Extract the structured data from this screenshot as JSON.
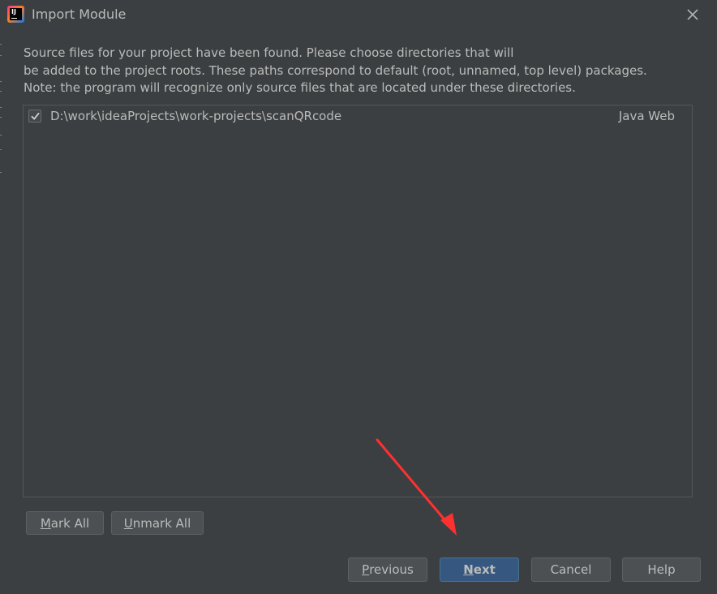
{
  "dialog": {
    "title": "Import Module",
    "close_icon": "close-icon",
    "app_icon": "intellij-idea-icon"
  },
  "description": {
    "line1": "Source files for your project have been found. Please choose directories that will",
    "line2": "be added to the project roots. These paths correspond to default (root, unnamed, top level) packages.",
    "line3": "Note: the program will recognize only source files that are located under these directories."
  },
  "roots": [
    {
      "checked": true,
      "path": "D:\\work\\ideaProjects\\work-projects\\scanQRcode",
      "type": "Java Web"
    }
  ],
  "list_buttons": {
    "mark_all": {
      "mnemonic": "M",
      "rest": "ark All"
    },
    "unmark_all": {
      "mnemonic": "U",
      "rest": "nmark All"
    }
  },
  "footer": {
    "previous": {
      "mnemonic": "P",
      "rest": "revious"
    },
    "next": {
      "mnemonic": "N",
      "rest": "ext"
    },
    "cancel": "Cancel",
    "help": "Help"
  },
  "colors": {
    "background": "#3c3f41",
    "primary_button": "#365880",
    "annotation_arrow": "#ff3030"
  }
}
